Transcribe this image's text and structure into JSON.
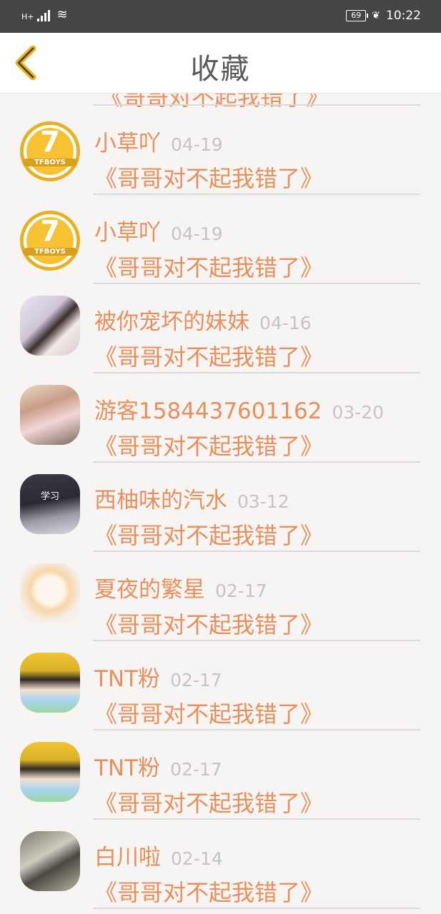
{
  "status": {
    "network": "H+",
    "battery": "69",
    "time": "10:22"
  },
  "header": {
    "title": "收藏"
  },
  "partial_row_text": "《哥哥对不起我错了》",
  "avatar_tfboys_label": "TFBOYS",
  "avatar_tfboys_number": "7",
  "avatar_study_label": "学习",
  "items": [
    {
      "name": "小草吖",
      "date": "04-19",
      "message": "《哥哥对不起我错了》"
    },
    {
      "name": "小草吖",
      "date": "04-19",
      "message": "《哥哥对不起我错了》"
    },
    {
      "name": "被你宠坏的妹妹",
      "date": "04-16",
      "message": "《哥哥对不起我错了》"
    },
    {
      "name": "游客1584437601162",
      "date": "03-20",
      "message": "《哥哥对不起我错了》"
    },
    {
      "name": "西柚味的汽水",
      "date": "03-12",
      "message": "《哥哥对不起我错了》"
    },
    {
      "name": "夏夜的繁星",
      "date": "02-17",
      "message": "《哥哥对不起我错了》"
    },
    {
      "name": "TNT粉",
      "date": "02-17",
      "message": "《哥哥对不起我错了》"
    },
    {
      "name": "TNT粉",
      "date": "02-17",
      "message": "《哥哥对不起我错了》"
    },
    {
      "name": "白川啦",
      "date": "02-14",
      "message": "《哥哥对不起我错了》"
    }
  ],
  "colors": {
    "accent": "#e88f5c",
    "date": "#c7c3c3",
    "back_arrow": "#f2b515",
    "background": "#f7f4f4"
  }
}
